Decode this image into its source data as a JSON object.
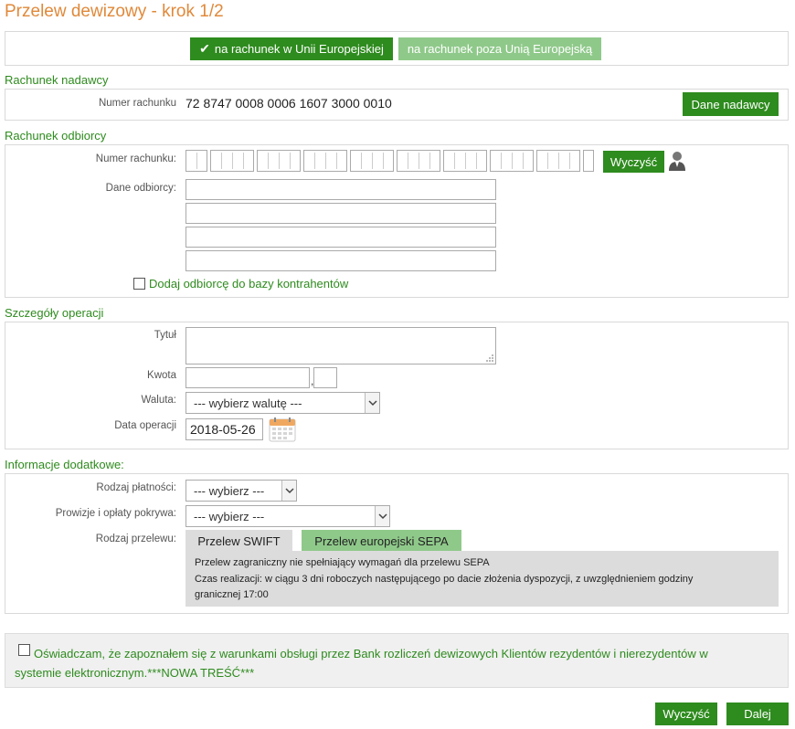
{
  "page": {
    "title": "Przelew dewizowy - krok 1/2"
  },
  "tabs_top": {
    "eu": "na rachunek w Unii Europejskiej",
    "non_eu": "na rachunek poza Unią Europejską"
  },
  "sender": {
    "section_title": "Rachunek nadawcy",
    "account_label": "Numer rachunku",
    "account_number": "72 8747 0008 0006 1607 3000 0010",
    "details_button": "Dane nadawcy"
  },
  "recipient": {
    "section_title": "Rachunek odbiorcy",
    "account_label": "Numer rachunku:",
    "clear_button": "Wyczyść",
    "data_label": "Dane odbiorcy:",
    "add_to_contacts": "Dodaj odbiorcę do bazy kontrahentów"
  },
  "operation": {
    "section_title": "Szczegóły operacji",
    "title_label": "Tytuł",
    "amount_label": "Kwota",
    "amount_sep": ",",
    "currency_label": "Waluta:",
    "currency_value": "--- wybierz walutę ---",
    "date_label": "Data operacji",
    "date_value": "2018-05-26"
  },
  "additional": {
    "section_title": "Informacje dodatkowe:",
    "payment_type_label": "Rodzaj płatności:",
    "payment_type_value": "--- wybierz ---",
    "fees_label": "Prowizje i opłaty pokrywa:",
    "fees_value": "--- wybierz ---",
    "transfer_type_label": "Rodzaj przelewu:",
    "tab_swift": "Przelew SWIFT",
    "tab_sepa": "Przelew europejski SEPA",
    "info_line1": "Przelew zagraniczny nie spełniający wymagań dla przelewu SEPA",
    "info_line2": "Czas realizacji: w ciągu 3 dni roboczych następującego po dacie złożenia dyspozycji, z uwzględnieniem godziny",
    "info_line3": "granicznej 17:00"
  },
  "declaration": {
    "line1": "Oświadczam, że zapoznałem się z warunkami obsługi przez Bank rozliczeń dewizowych Klientów rezydentów i nierezydentów w",
    "line2": "systemie elektronicznym.***NOWA TREŚĆ***"
  },
  "footer": {
    "clear": "Wyczyść",
    "next": "Dalej"
  },
  "colors": {
    "primary_green": "#2e8b1e",
    "light_green": "#8fc98a",
    "title_orange": "#e0893a"
  },
  "icons": {
    "check": "check-icon",
    "person": "person-icon",
    "calendar": "calendar-icon",
    "chevron": "chevron-down-icon",
    "resize": "resize-grip-icon"
  }
}
